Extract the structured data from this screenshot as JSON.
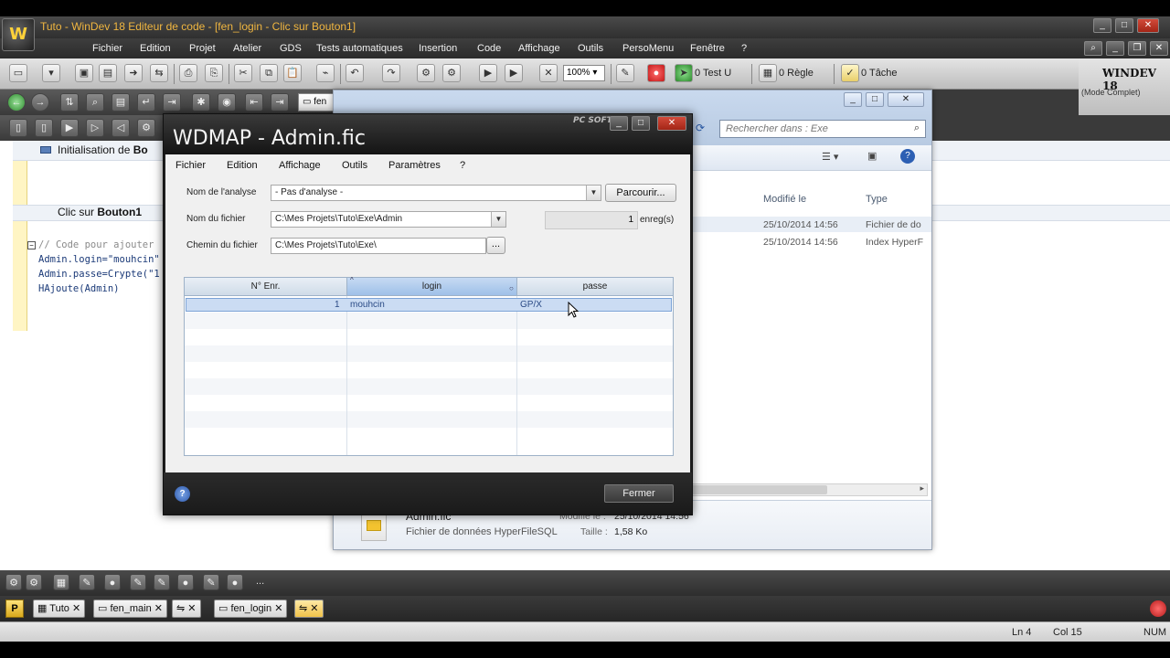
{
  "window": {
    "title": "Tuto - WinDev 18  Editeur de code - [fen_login - Clic sur Bouton1]",
    "logo_text": "W"
  },
  "menu": [
    "Fichier",
    "Edition",
    "Projet",
    "Atelier",
    "GDS",
    "Tests automatiques",
    "Insertion",
    "Code",
    "Affichage",
    "Outils",
    "PersoMenu",
    "Fenêtre",
    "?"
  ],
  "toolbar": {
    "zoom": "100%",
    "test_label": "0 Test U",
    "rule_label": "0 Règle",
    "task_label": "0 Tâche",
    "brand": "WINDEV 18",
    "mode": "(Mode Complet)"
  },
  "editor": {
    "section1": "Initialisation de Bo",
    "section1_bold": "Bo",
    "section2_prefix": "Clic sur ",
    "section2_bold": "Bouton1",
    "code_lines": [
      "// Code pour ajouter",
      "Admin.login=\"mouhcin\"",
      "Admin.passe=Crypte(\"1",
      "HAjoute(Admin)"
    ]
  },
  "explorer": {
    "search_placeholder": "Rechercher dans : Exe",
    "tab_label": "fen",
    "columns": [
      "Modifié le",
      "Type"
    ],
    "rows": [
      {
        "modified": "25/10/2014 14:56",
        "type": "Fichier de do"
      },
      {
        "modified": "25/10/2014 14:56",
        "type": "Index HyperF"
      }
    ],
    "detail": {
      "name": "Admin.fic",
      "type": "Fichier de données HyperFileSQL",
      "modified_label": "Modifié le :",
      "modified_value": "25/10/2014 14:56",
      "size_label": "Taille :",
      "size_value": "1,58 Ko"
    }
  },
  "wdmap": {
    "title": "WDMAP - Admin.fic",
    "brand": "PC SOFT",
    "menu": [
      "Fichier",
      "Edition",
      "Affichage",
      "Outils",
      "Paramètres",
      "?"
    ],
    "analysis_label": "Nom de l'analyse",
    "analysis_value": "- Pas d'analyse -",
    "browse_button": "Parcourir...",
    "file_label": "Nom du fichier",
    "file_value": "C:\\Mes Projets\\Tuto\\Exe\\Admin",
    "count_value": "1",
    "count_unit": "enreg(s)",
    "path_label": "Chemin du fichier",
    "path_value": "C:\\Mes Projets\\Tuto\\Exe\\",
    "path_button": "...",
    "grid": {
      "columns": [
        "N° Enr.",
        "login",
        "passe"
      ],
      "rows": [
        {
          "num": "1",
          "login": "mouhcin",
          "passe": "GP/X"
        }
      ]
    },
    "help_icon": "?",
    "close_button": "Fermer"
  },
  "tabs": [
    {
      "label": "Tuto",
      "active": false
    },
    {
      "label": "fen_main",
      "active": false
    },
    {
      "label": "",
      "active": false
    },
    {
      "label": "fen_login",
      "active": false
    },
    {
      "label": "",
      "active": true
    }
  ],
  "status": {
    "line": "Ln 4",
    "col": "Col 15",
    "num": "NUM"
  }
}
